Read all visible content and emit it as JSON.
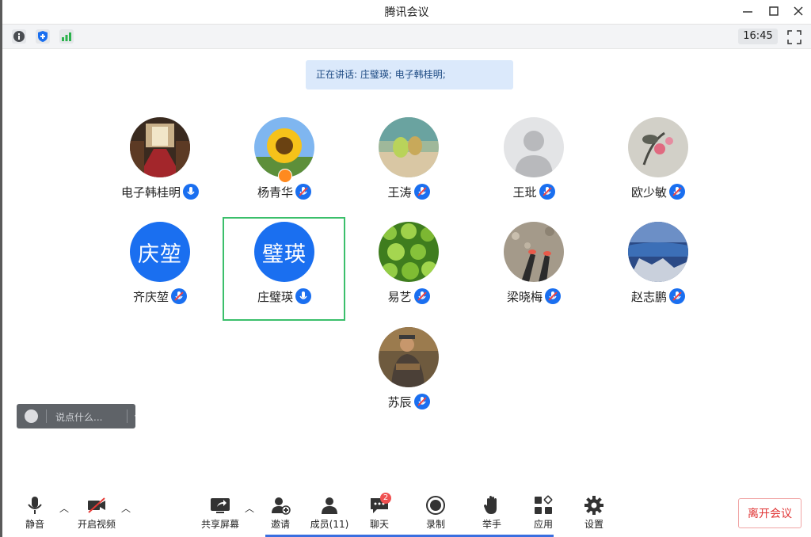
{
  "window": {
    "title": "腾讯会议"
  },
  "statusbar": {
    "time": "16:45"
  },
  "speaking_banner": "正在讲话: 庄璧瑛; 电子韩桂明;",
  "participants": [
    {
      "name": "电子韩桂明",
      "avatar": "photo-hall"
    },
    {
      "name": "杨青华",
      "avatar": "photo-sunflower",
      "host": true
    },
    {
      "name": "王涛",
      "avatar": "photo-cactus"
    },
    {
      "name": "王玭",
      "avatar": "default-person"
    },
    {
      "name": "欧少敏",
      "avatar": "photo-painting"
    },
    {
      "name": "齐庆堃",
      "avatar_text": "庆堃"
    },
    {
      "name": "庄璧瑛",
      "avatar_text": "璧瑛",
      "selected": true
    },
    {
      "name": "易艺",
      "avatar": "photo-leaves"
    },
    {
      "name": "梁晓梅",
      "avatar": "photo-feet"
    },
    {
      "name": "赵志鹏",
      "avatar": "photo-lake"
    },
    {
      "name": "苏辰",
      "avatar": "photo-man"
    }
  ],
  "chat": {
    "placeholder": "说点什么..."
  },
  "toolbar": {
    "mute": "静音",
    "video": "开启视频",
    "share": "共享屏幕",
    "invite": "邀请",
    "members": "成员(11)",
    "chat": "聊天",
    "chat_badge": "2",
    "record": "录制",
    "raise_hand": "举手",
    "apps": "应用",
    "settings": "设置",
    "leave": "离开会议"
  },
  "colors": {
    "accent": "#1a6ff0",
    "leave": "#e03434",
    "selected_border": "#3bbf6b"
  }
}
